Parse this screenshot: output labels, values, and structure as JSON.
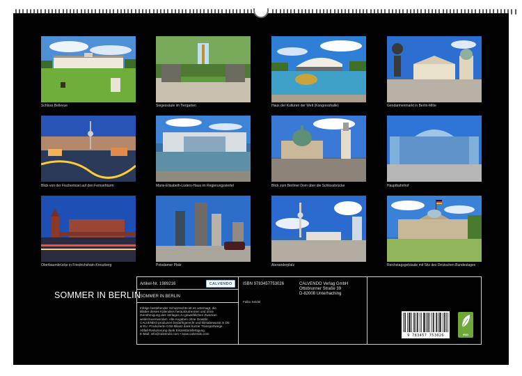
{
  "calendar": {
    "title": "SOMMER IN BERLIN",
    "photos": [
      {
        "caption": "Schloss Bellevue",
        "scene": "palace-lawn"
      },
      {
        "caption": "Siegessäule im Tiergarten",
        "scene": "park-monument"
      },
      {
        "caption": "Haus der Kulturen der Welt (Kongresshalle)",
        "scene": "congress-hall"
      },
      {
        "caption": "Gendarmenmarkt in Berlin-Mitte",
        "scene": "square-domes"
      },
      {
        "caption": "Blick von der Fischerinsel auf den Fernsehturm",
        "scene": "city-dusk"
      },
      {
        "caption": "Marie-Elisabeth-Lüders-Haus im Regierungsviertel",
        "scene": "modern-river"
      },
      {
        "caption": "Blick zum Berliner Dom über die Schlossbrücke",
        "scene": "cathedral"
      },
      {
        "caption": "Hauptbahnhof",
        "scene": "glass-station"
      },
      {
        "caption": "Oberbaumbrücke in Friedrichshain-Kreuzberg",
        "scene": "bridge-night"
      },
      {
        "caption": "Potsdamer Platz",
        "scene": "skyscrapers"
      },
      {
        "caption": "Alexanderplatz",
        "scene": "tv-tower"
      },
      {
        "caption": "Reichstagsgebäude mit Sitz des Deutschen Bundestages",
        "scene": "reichstag"
      }
    ]
  },
  "imprint": {
    "article_number": "Artikel-Nr. 1989216",
    "logo_text": "CALVENDO",
    "title": "SOMMER IN BERLIN",
    "legal_text": [
      "Infolge bestehender Schutzrechte ist es untersagt, die",
      "Blätter dieses Kalenders herauszutrennen und ohne",
      "Genehmigung des Verlages zu gewerblichen Zwecken",
      "weiterzuverwenden. Alle Angaben ohne Gewähr.",
      "CALVENDO produziert bedarfsgerecht und klimabewusst in DE",
      "& EU. Produzierte CO2-Bilanz dank kurzer Transportwege.",
      "Abfall-Reduzierung dank Einzelstückfertigung.",
      "E-Mail: info@calvendo.com • www.calvendo.com"
    ],
    "isbn": "ISBN 9783457753026",
    "author": "Falko Seidel",
    "publisher": [
      "CALVENDO Verlag GmbH",
      "Ottobrunner Straße 39",
      "D-82008 Unterhaching"
    ],
    "barcode_number": "9 783457 753026",
    "eco_label": "eco"
  },
  "colors": {
    "background": "#020202",
    "text": "#ffffff",
    "caption": "#d6d6d6",
    "frame_lines": "#cfcfcf",
    "eco_green": "#6ea83a",
    "logo_blue": "#1d5f92"
  }
}
